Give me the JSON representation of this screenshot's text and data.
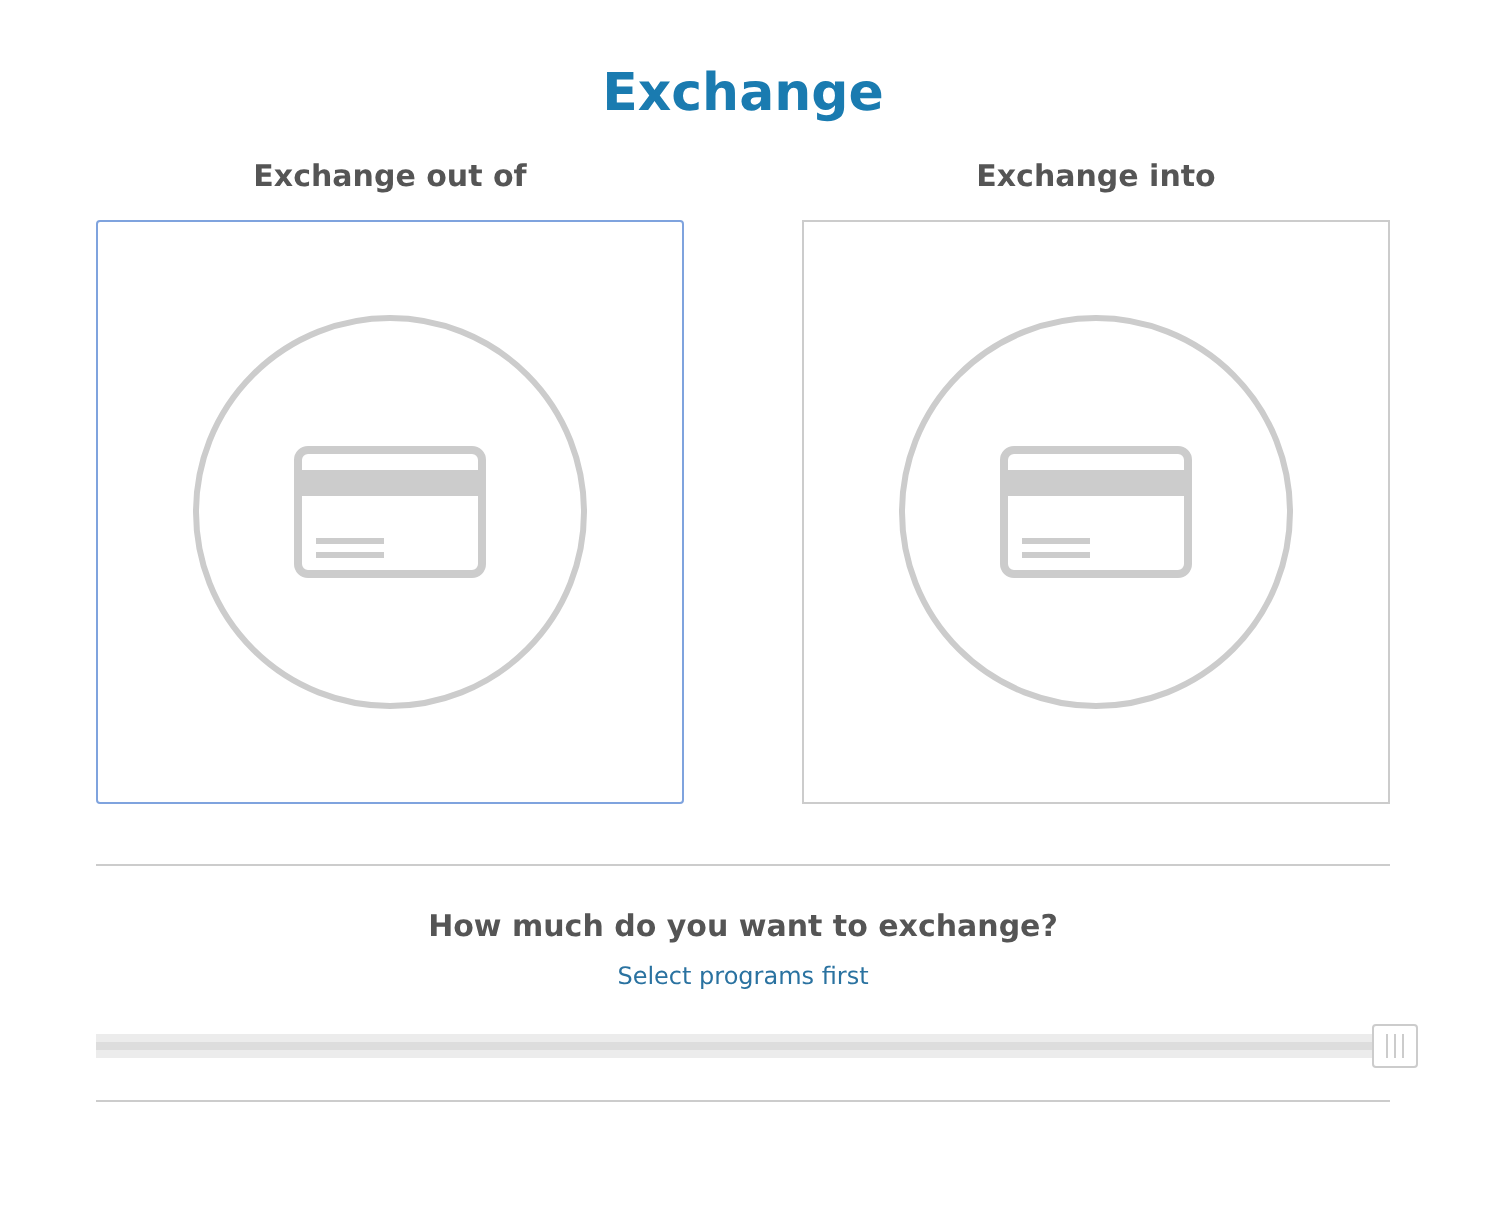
{
  "title": "Exchange",
  "panels": [
    {
      "heading": "Exchange out of",
      "selected": true
    },
    {
      "heading": "Exchange into",
      "selected": false
    }
  ],
  "amount": {
    "question": "How much do you want to exchange?",
    "hint": "Select programs first",
    "level": 1
  }
}
